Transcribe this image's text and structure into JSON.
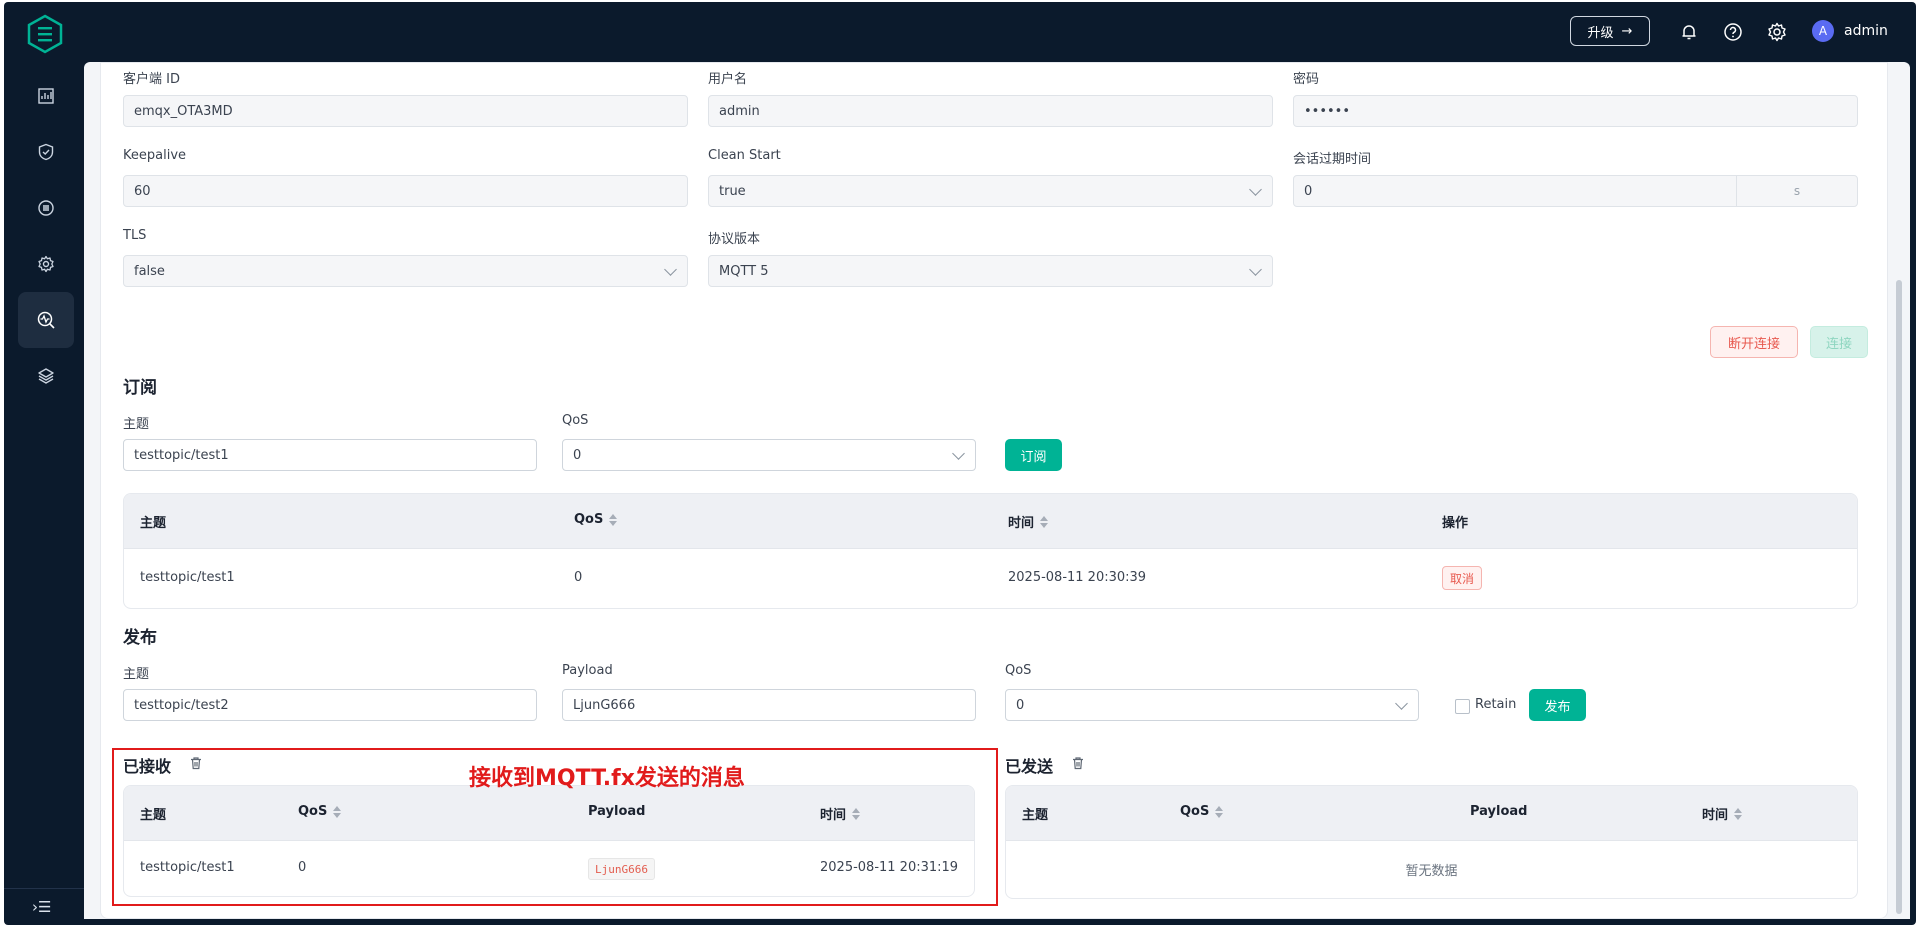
{
  "topbar": {
    "upgrade_label": "升级",
    "user_initial": "A",
    "user_name": "admin"
  },
  "icons": {
    "logo": "emqx-logo",
    "bell": "bell-icon",
    "help": "help-icon",
    "settings": "gear-icon",
    "collapse": "collapse-sidebar-icon"
  },
  "sidebar": {
    "items": [
      {
        "name": "dashboard"
      },
      {
        "name": "access-control"
      },
      {
        "name": "integration"
      },
      {
        "name": "management"
      },
      {
        "name": "diagnose",
        "active": true
      },
      {
        "name": "extensions"
      }
    ],
    "collapse_glyph": "›☰"
  },
  "connection": {
    "client_id_label": "客户端 ID",
    "client_id": "emqx_OTA3MD",
    "username_label": "用户名",
    "username": "admin",
    "password_label": "密码",
    "password": "••••••",
    "keepalive_label": "Keepalive",
    "keepalive": "60",
    "clean_start_label": "Clean Start",
    "clean_start": "true",
    "session_expiry_label": "会话过期时间",
    "session_expiry": "0",
    "session_expiry_unit": "s",
    "tls_label": "TLS",
    "tls": "false",
    "protocol_label": "协议版本",
    "protocol": "MQTT 5",
    "disconnect_label": "断开连接",
    "connect_label": "连接"
  },
  "subscribe": {
    "title": "订阅",
    "topic_label": "主题",
    "topic": "testtopic/test1",
    "qos_label": "QoS",
    "qos": "0",
    "button": "订阅",
    "columns": [
      "主题",
      "QoS",
      "时间",
      "操作"
    ],
    "rows": [
      {
        "topic": "testtopic/test1",
        "qos": "0",
        "time": "2025-08-11 20:30:39",
        "action": "取消"
      }
    ]
  },
  "publish": {
    "title": "发布",
    "topic_label": "主题",
    "topic": "testtopic/test2",
    "payload_label": "Payload",
    "payload": "LjunG666",
    "qos_label": "QoS",
    "qos": "0",
    "retain_label": "Retain",
    "button": "发布"
  },
  "received": {
    "title": "已接收",
    "columns": [
      "主题",
      "QoS",
      "Payload",
      "时间"
    ],
    "rows": [
      {
        "topic": "testtopic/test1",
        "qos": "0",
        "payload": "LjunG666",
        "time": "2025-08-11 20:31:19"
      }
    ],
    "annotation": "接收到MQTT.fx发送的消息"
  },
  "sent": {
    "title": "已发送",
    "columns": [
      "主题",
      "QoS",
      "Payload",
      "时间"
    ],
    "empty": "暂无数据"
  },
  "colors": {
    "sidebar_bg": "#0b1a2c",
    "primary": "#00b395",
    "danger": "#e85a50",
    "annotation": "#e11b1b"
  }
}
